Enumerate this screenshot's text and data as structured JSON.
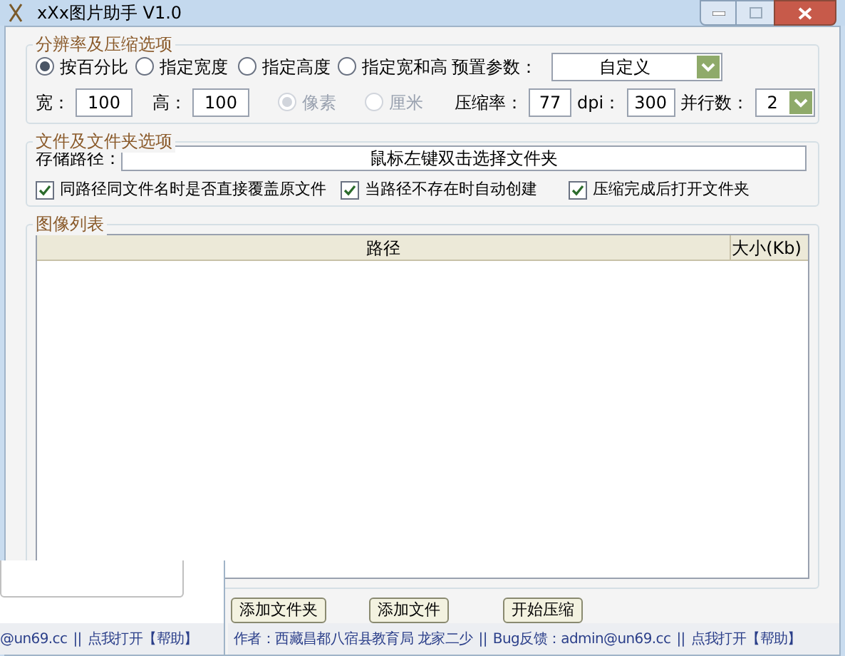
{
  "window": {
    "title": "xXx图片助手 V1.0"
  },
  "resolution_group": {
    "title": "分辨率及压缩选项",
    "modes": [
      {
        "label": "按百分比",
        "selected": true
      },
      {
        "label": "指定宽度",
        "selected": false
      },
      {
        "label": "指定高度",
        "selected": false
      },
      {
        "label": "指定宽和高",
        "selected": false
      }
    ],
    "preset": {
      "label": "预置参数：",
      "value": "自定义"
    },
    "width": {
      "label": "宽：",
      "value": "100"
    },
    "height": {
      "label": "高：",
      "value": "100"
    },
    "units": [
      {
        "label": "像素",
        "selected": true,
        "disabled": true
      },
      {
        "label": "厘米",
        "selected": false,
        "disabled": true
      }
    ],
    "compression": {
      "label": "压缩率：",
      "value": "77"
    },
    "dpi": {
      "label": "dpi：",
      "value": "300"
    },
    "threads": {
      "label": "并行数：",
      "value": "2"
    }
  },
  "file_group": {
    "title": "文件及文件夹选项",
    "save_path": {
      "label": "存储路径：",
      "value": "鼠标左键双击选择文件夹"
    },
    "options": [
      {
        "label": "同路径同文件名时是否直接覆盖原文件",
        "checked": true
      },
      {
        "label": "当路径不存在时自动创建",
        "checked": true
      },
      {
        "label": "压缩完成后打开文件夹",
        "checked": true
      }
    ]
  },
  "image_list": {
    "title": "图像列表",
    "columns": [
      "路径",
      "大小(Kb)"
    ]
  },
  "buttons": [
    "添加文件夹",
    "添加文件",
    "开始压缩"
  ],
  "status_bar": {
    "author": "作者：西藏昌都八宿县教育局 龙家二少",
    "separator": "||",
    "bug": "Bug反馈：admin@un69.cc",
    "separator2": "||",
    "help": "点我打开【帮助】"
  },
  "background_window": {
    "status_email": "@un69.cc",
    "separator": "||",
    "help": "点我打开【帮助】"
  }
}
